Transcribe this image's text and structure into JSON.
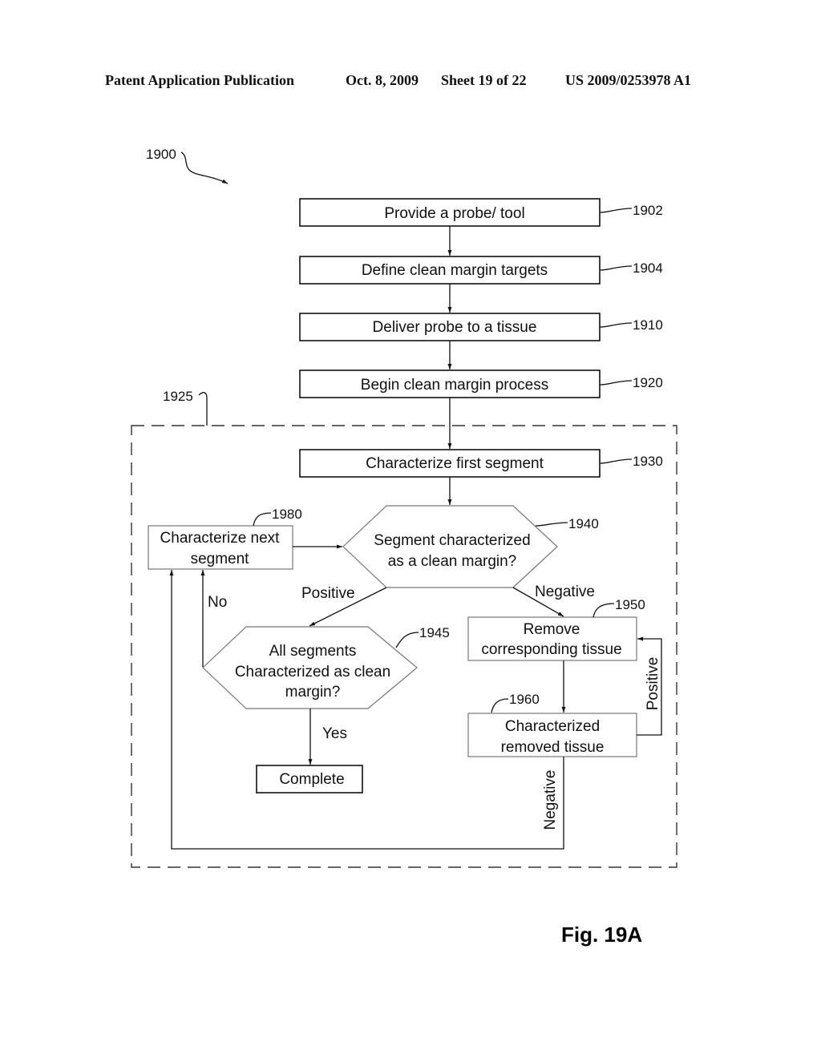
{
  "header": {
    "publication": "Patent Application Publication",
    "date": "Oct. 8, 2009",
    "sheet": "Sheet 19 of 22",
    "number": "US 2009/0253978 A1"
  },
  "diagram": {
    "figure_ref": "1900",
    "group_ref": "1925",
    "figure_label": "Fig. 19A",
    "nodes": [
      {
        "id": "1902",
        "ref": "1902",
        "shape": "box",
        "lines": [
          "Provide a probe/ tool"
        ]
      },
      {
        "id": "1904",
        "ref": "1904",
        "shape": "box",
        "lines": [
          "Define clean margin targets"
        ]
      },
      {
        "id": "1910",
        "ref": "1910",
        "shape": "box",
        "lines": [
          "Deliver probe to a tissue"
        ]
      },
      {
        "id": "1920",
        "ref": "1920",
        "shape": "box",
        "lines": [
          "Begin clean margin process"
        ]
      },
      {
        "id": "1930",
        "ref": "1930",
        "shape": "box",
        "lines": [
          "Characterize first  segment"
        ]
      },
      {
        "id": "1940",
        "ref": "1940",
        "shape": "hexagon",
        "lines": [
          "Segment characterized",
          "as a clean margin?"
        ]
      },
      {
        "id": "1945",
        "ref": "1945",
        "shape": "hexagon",
        "lines": [
          "All segments",
          "Characterized as clean",
          "margin?"
        ]
      },
      {
        "id": "1950",
        "ref": "1950",
        "shape": "box",
        "lines": [
          "Remove",
          "corresponding tissue"
        ]
      },
      {
        "id": "1960",
        "ref": "1960",
        "shape": "box",
        "lines": [
          "Characterized",
          "removed tissue"
        ]
      },
      {
        "id": "1980",
        "ref": "1980",
        "shape": "box",
        "lines": [
          "Characterize next",
          "segment"
        ]
      },
      {
        "id": "complete",
        "ref": "",
        "shape": "box",
        "lines": [
          "Complete"
        ]
      }
    ],
    "edges": [
      {
        "from": "1902",
        "to": "1904",
        "label": ""
      },
      {
        "from": "1904",
        "to": "1910",
        "label": ""
      },
      {
        "from": "1910",
        "to": "1920",
        "label": ""
      },
      {
        "from": "1920",
        "to": "1930",
        "label": ""
      },
      {
        "from": "1930",
        "to": "1940",
        "label": ""
      },
      {
        "from": "1940",
        "to": "1945",
        "label": "Positive"
      },
      {
        "from": "1940",
        "to": "1950",
        "label": "Negative"
      },
      {
        "from": "1945",
        "to": "complete",
        "label": "Yes"
      },
      {
        "from": "1945",
        "to": "1980",
        "label": "No"
      },
      {
        "from": "1950",
        "to": "1960",
        "label": ""
      },
      {
        "from": "1960",
        "to": "1950",
        "label": "Positive"
      },
      {
        "from": "1960",
        "to": "1980",
        "label": "Negative"
      },
      {
        "from": "1980",
        "to": "1940",
        "label": ""
      }
    ]
  }
}
